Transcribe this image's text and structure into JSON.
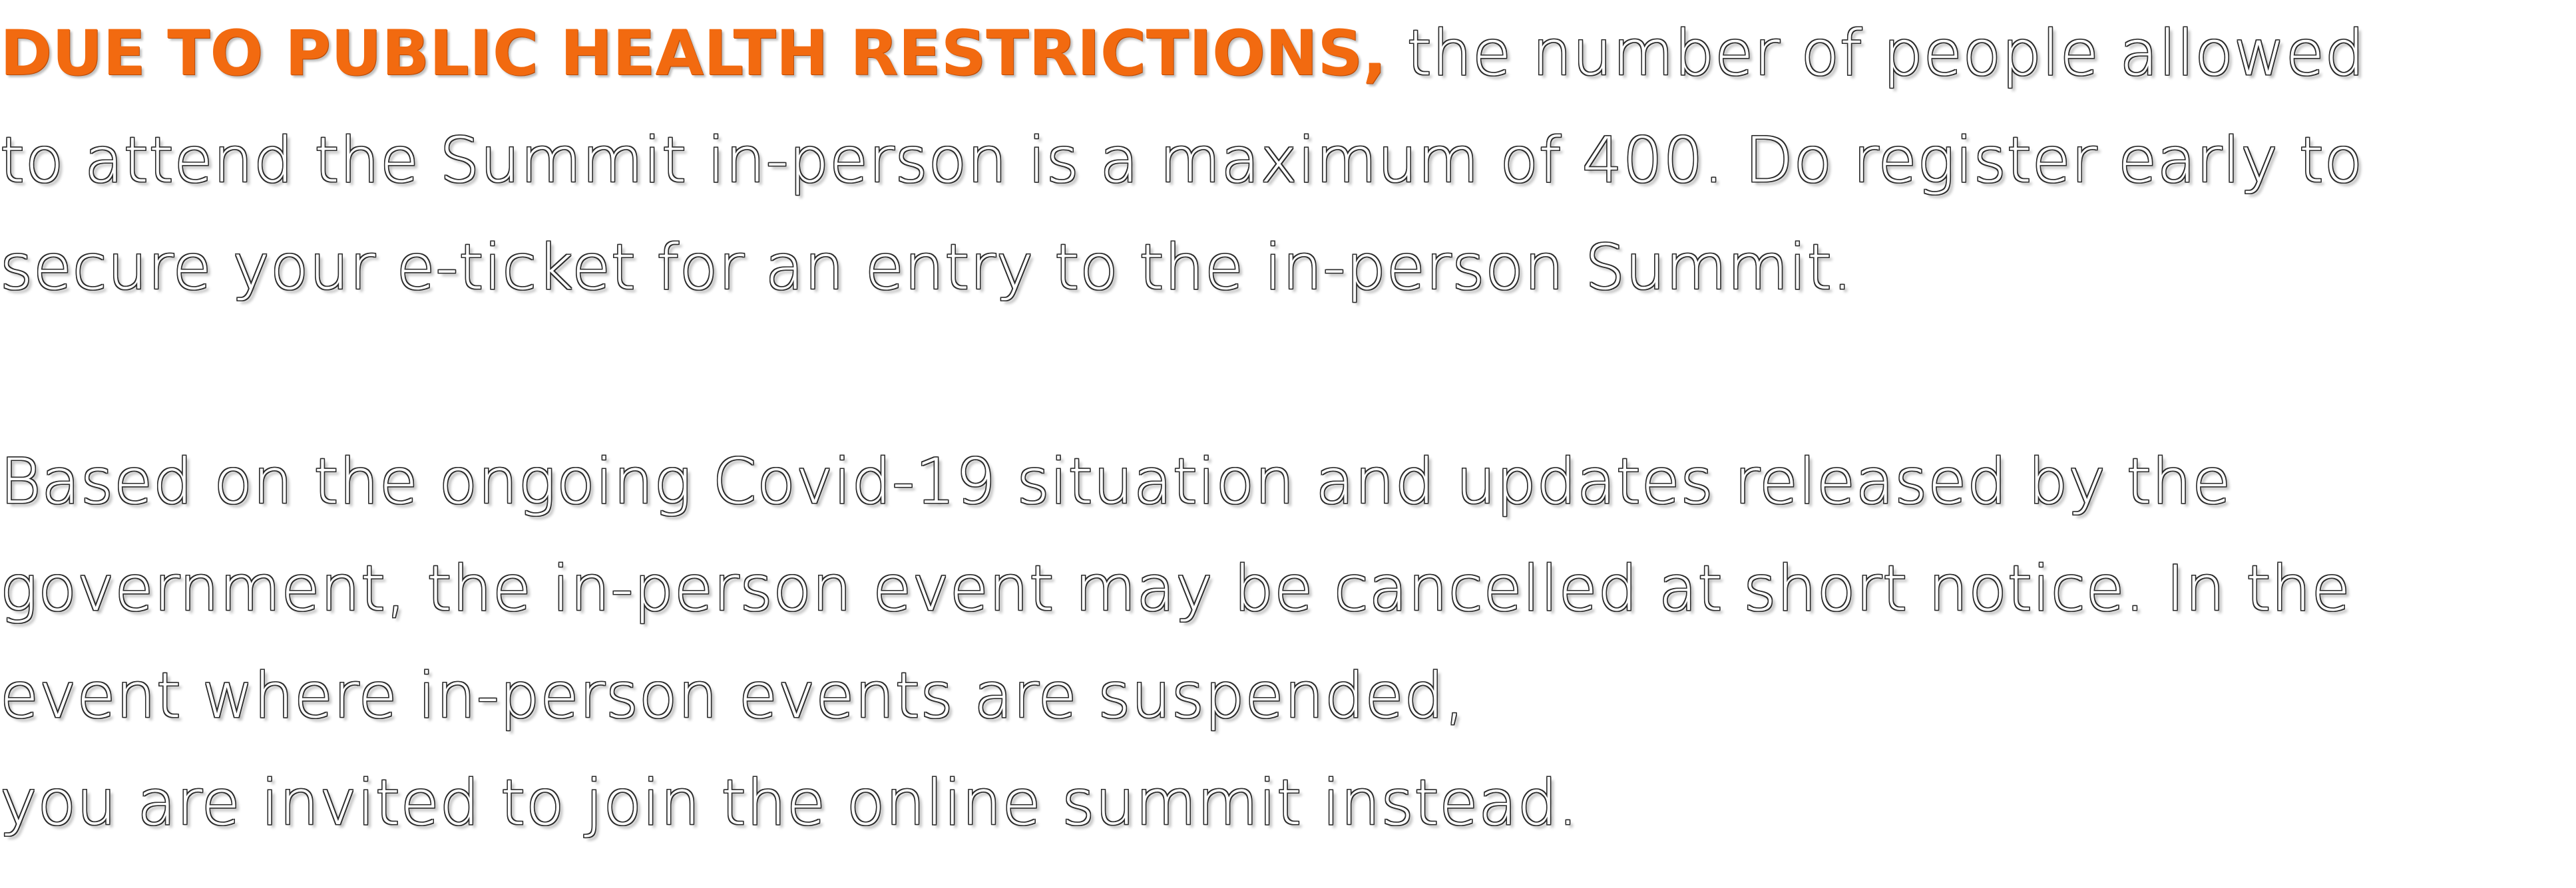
{
  "notice": {
    "paragraph_1": {
      "emphasis": "DUE TO PUBLIC HEALTH RESTRICTIONS,",
      "line_1_rest": " the number of people allowed",
      "line_2": "to attend the Summit in-person is a maximum of 400. Do register early to",
      "line_3": "secure your e-ticket for an entry to the in-person Summit."
    },
    "paragraph_2": {
      "line_1": "Based on the ongoing Covid-19 situation and updates released by the",
      "line_2": "government, the in-person event may be cancelled at short notice. In the",
      "line_3": "event where in-person events are suspended,",
      "line_4": "you are invited to join the online summit instead."
    }
  },
  "colors": {
    "accent": "#f26a10",
    "background": "#ffffff",
    "text_outline": "#2a2a2a"
  }
}
